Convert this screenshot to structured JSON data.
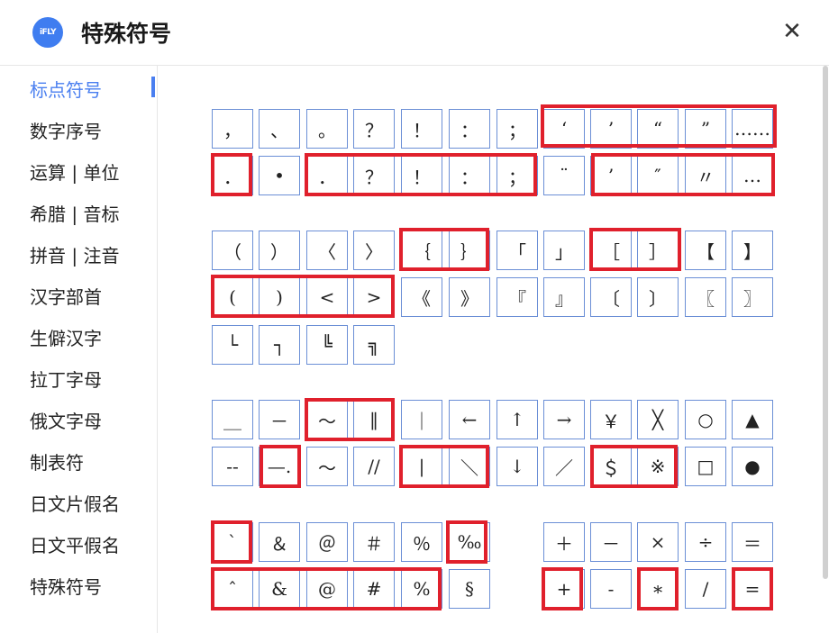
{
  "header": {
    "logo_text": "iFLY",
    "title": "特殊符号",
    "close_icon": "close-icon"
  },
  "sidebar": {
    "items": [
      {
        "label": "标点符号",
        "active": true
      },
      {
        "label": "数字序号"
      },
      {
        "label": "运算 | 单位"
      },
      {
        "label": "希腊 | 音标"
      },
      {
        "label": "拼音 | 注音"
      },
      {
        "label": "汉字部首"
      },
      {
        "label": "生僻汉字"
      },
      {
        "label": "拉丁字母"
      },
      {
        "label": "俄文字母"
      },
      {
        "label": "制表符"
      },
      {
        "label": "日文片假名"
      },
      {
        "label": "日文平假名"
      },
      {
        "label": "特殊符号"
      }
    ]
  },
  "symbols": {
    "row1": [
      "，",
      "、",
      "。",
      "？",
      "！",
      "：",
      "；",
      "‘",
      "’",
      "“",
      "”",
      "……"
    ],
    "row2": [
      "．",
      "•",
      "．",
      "？",
      "！",
      "：",
      "；",
      "¨",
      "’",
      "″",
      "〃",
      "…"
    ],
    "row3": [
      "（",
      "）",
      "〈",
      "〉",
      "｛",
      "｝",
      "「",
      "」",
      "［",
      "］",
      "【",
      "】"
    ],
    "row4": [
      "(",
      ")",
      "<",
      ">",
      "《",
      "》",
      "『",
      "』",
      "〔",
      "〕",
      "〖",
      "〗"
    ],
    "row5": [
      "└",
      "┐",
      "╚",
      "╗"
    ],
    "row6": [
      "＿",
      "－",
      "～",
      "‖",
      "｜",
      "←",
      "↑",
      "→",
      "￥",
      "╳",
      "○",
      "▲"
    ],
    "row7": [
      "--",
      "—.",
      "〜",
      "//",
      "|",
      "＼",
      "↓",
      "／",
      "＄",
      "※",
      "□",
      "●"
    ],
    "row8": [
      "`",
      "＆",
      "＠",
      "＃",
      "％",
      "‰",
      "＋",
      "－",
      "×",
      "÷",
      "＝"
    ],
    "row9": [
      "ˆ",
      "&",
      "@",
      "#",
      "%",
      "§",
      "+",
      "-",
      "∗",
      "/",
      "="
    ]
  }
}
